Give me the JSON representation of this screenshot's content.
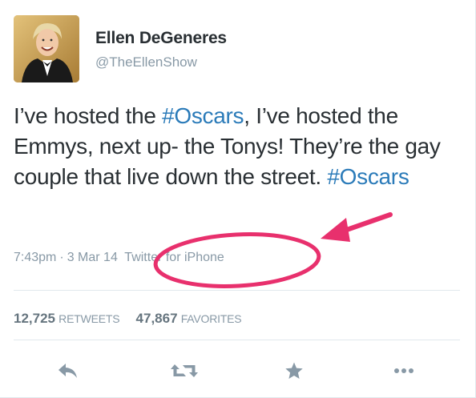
{
  "author": {
    "name": "Ellen DeGeneres",
    "handle": "@TheEllenShow"
  },
  "tweet": {
    "text_1": "I’ve hosted the ",
    "hashtag_1": "#Oscars",
    "text_2": ", I’ve hosted the Emmys, next up- the Tonys! They’re the gay couple that live down the street. ",
    "hashtag_2": "#Oscars"
  },
  "meta": {
    "time": "7:43pm",
    "separator": "·",
    "date": "3 Mar 14",
    "source": "Twitter for iPhone"
  },
  "stats": {
    "retweets_count": "12,725",
    "retweets_label": "RETWEETS",
    "favorites_count": "47,867",
    "favorites_label": "FAVORITES"
  },
  "actions": {
    "reply_icon": "reply-icon",
    "retweet_icon": "retweet-icon",
    "favorite_icon": "star-icon",
    "more_icon": "more-icon"
  },
  "colors": {
    "hashtag": "#2b7bb9",
    "annotation": "#e8306d",
    "muted": "#8899a6"
  }
}
